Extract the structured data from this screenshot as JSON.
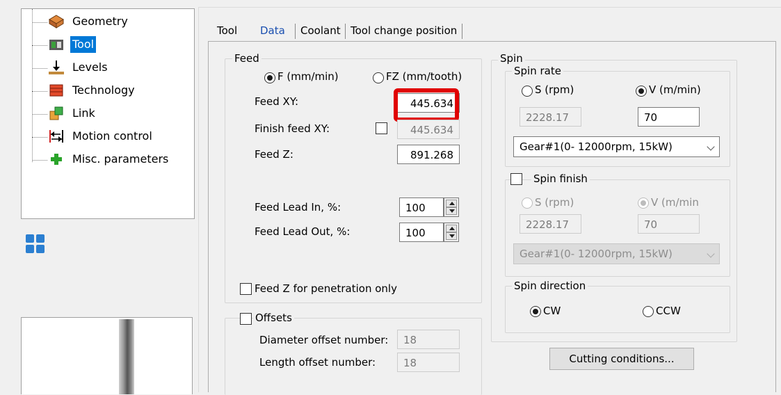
{
  "tree": {
    "items": [
      {
        "label": "Geometry",
        "icon": "geometry-icon"
      },
      {
        "label": "Tool",
        "icon": "tool-icon"
      },
      {
        "label": "Levels",
        "icon": "levels-icon"
      },
      {
        "label": "Technology",
        "icon": "technology-icon"
      },
      {
        "label": "Link",
        "icon": "link-icon"
      },
      {
        "label": "Motion control",
        "icon": "motion-control-icon"
      },
      {
        "label": "Misc. parameters",
        "icon": "misc-parameters-icon"
      }
    ],
    "selected": "Tool"
  },
  "tabs": [
    "Tool",
    "Data",
    "Coolant",
    "Tool change position"
  ],
  "active_tab": "Data",
  "feed": {
    "title": "Feed",
    "radio_f": "F (mm/min)",
    "radio_fz": "FZ (mm/tooth)",
    "feed_xy_label": "Feed XY:",
    "feed_xy_value": "445.634",
    "finish_feed_xy_label": "Finish feed XY:",
    "finish_feed_xy_value": "445.634",
    "feed_z_label": "Feed Z:",
    "feed_z_value": "891.268",
    "lead_in_label": "Feed Lead In, %:",
    "lead_in_value": "100",
    "lead_out_label": "Feed Lead Out, %:",
    "lead_out_value": "100",
    "penetration_label": "Feed Z for penetration only"
  },
  "offsets": {
    "title": "Offsets",
    "diameter_label": "Diameter offset number:",
    "diameter_value": "18",
    "length_label": "Length offset number:",
    "length_value": "18"
  },
  "spin": {
    "title": "Spin",
    "rate_title": "Spin rate",
    "radio_s": "S (rpm)",
    "radio_v": "V (m/min)",
    "s_value": "2228.17",
    "v_value": "70",
    "gear": "Gear#1(0- 12000rpm, 15kW)",
    "finish_title": "Spin finish",
    "finish_radio_s": "S (rpm)",
    "finish_radio_v": "V (m/min",
    "finish_s_value": "2228.17",
    "finish_v_value": "70",
    "finish_gear": "Gear#1(0- 12000rpm, 15kW)",
    "direction_title": "Spin direction",
    "cw": "CW",
    "ccw": "CCW"
  },
  "cutting_conditions_button": "Cutting conditions...",
  "colors": {
    "highlight": "#e00000",
    "selection": "#0078d7",
    "active_tab": "#1a4fb0"
  }
}
